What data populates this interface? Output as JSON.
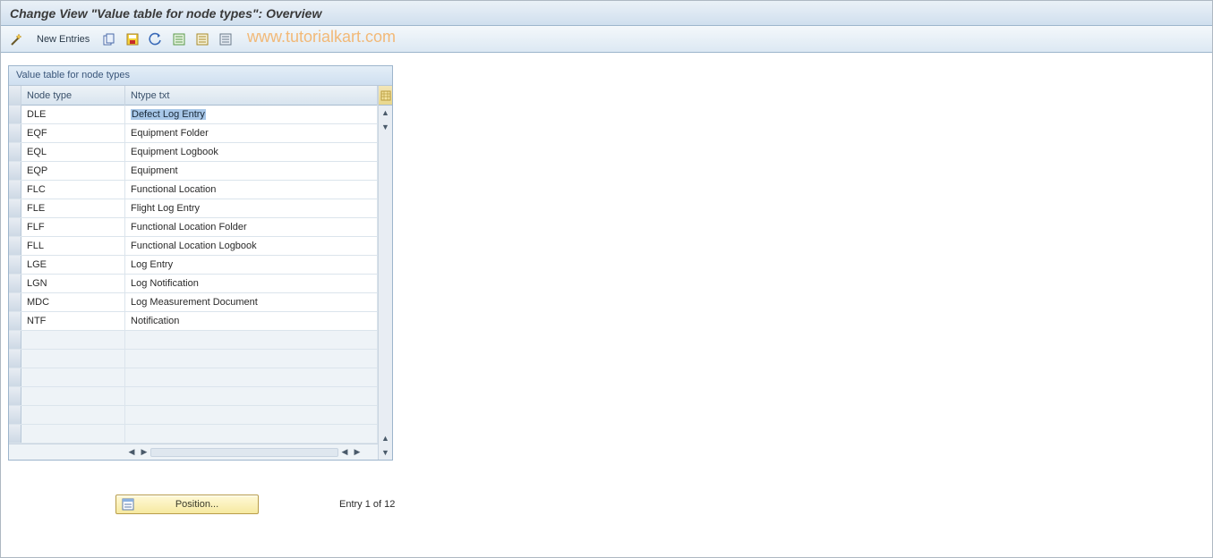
{
  "title": "Change View \"Value table for node types\": Overview",
  "toolbar": {
    "new_entries_label": "New Entries"
  },
  "watermark": "www.tutorialkart.com",
  "groupbox": {
    "title": "Value table for node types",
    "columns": {
      "c1": "Node type",
      "c2": "Ntype txt"
    },
    "rows": [
      {
        "node_type": "DLE",
        "ntype_txt": "Defect Log Entry"
      },
      {
        "node_type": "EQF",
        "ntype_txt": "Equipment Folder"
      },
      {
        "node_type": "EQL",
        "ntype_txt": "Equipment Logbook"
      },
      {
        "node_type": "EQP",
        "ntype_txt": "Equipment"
      },
      {
        "node_type": "FLC",
        "ntype_txt": "Functional Location"
      },
      {
        "node_type": "FLE",
        "ntype_txt": "Flight Log Entry"
      },
      {
        "node_type": "FLF",
        "ntype_txt": "Functional Location Folder"
      },
      {
        "node_type": "FLL",
        "ntype_txt": "Functional Location Logbook"
      },
      {
        "node_type": "LGE",
        "ntype_txt": "Log Entry"
      },
      {
        "node_type": "LGN",
        "ntype_txt": "Log Notification"
      },
      {
        "node_type": "MDC",
        "ntype_txt": "Log Measurement Document"
      },
      {
        "node_type": "NTF",
        "ntype_txt": "Notification"
      }
    ],
    "empty_rows": 6
  },
  "footer": {
    "position_label": "Position...",
    "entry_status": "Entry 1 of 12"
  }
}
